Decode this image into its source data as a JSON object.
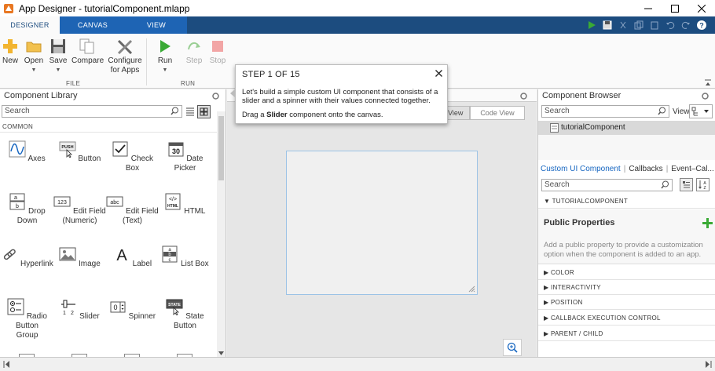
{
  "window": {
    "title": "App Designer - tutorialComponent.mlapp"
  },
  "tabs": [
    {
      "label": "DESIGNER"
    },
    {
      "label": "CANVAS"
    },
    {
      "label": "VIEW"
    }
  ],
  "toolstrip": {
    "new": "New",
    "open": "Open",
    "save": "Save",
    "compare": "Compare",
    "configure_l1": "Configure",
    "configure_l2": "for Apps",
    "run": "Run",
    "step": "Step",
    "stop": "Stop",
    "file_group": "FILE",
    "run_group": "RUN"
  },
  "library": {
    "title": "Component Library",
    "search_placeholder": "Search",
    "section": "COMMON",
    "components": [
      {
        "l1": "Axes",
        "l2": "",
        "l3": ""
      },
      {
        "l1": "Button",
        "l2": "",
        "l3": ""
      },
      {
        "l1": "Check Box",
        "l2": "",
        "l3": ""
      },
      {
        "l1": "Date Picker",
        "l2": "",
        "l3": ""
      },
      {
        "l1": "Drop Down",
        "l2": "",
        "l3": ""
      },
      {
        "l1": "Edit Field",
        "l2": "(Numeric)",
        "l3": ""
      },
      {
        "l1": "Edit Field",
        "l2": "(Text)",
        "l3": ""
      },
      {
        "l1": "HTML",
        "l2": "",
        "l3": ""
      },
      {
        "l1": "Hyperlink",
        "l2": "",
        "l3": ""
      },
      {
        "l1": "Image",
        "l2": "",
        "l3": ""
      },
      {
        "l1": "Label",
        "l2": "",
        "l3": ""
      },
      {
        "l1": "List Box",
        "l2": "",
        "l3": ""
      },
      {
        "l1": "Radio Button",
        "l2": "Group",
        "l3": ""
      },
      {
        "l1": "Slider",
        "l2": "",
        "l3": ""
      },
      {
        "l1": "Spinner",
        "l2": "",
        "l3": ""
      },
      {
        "l1": "State Button",
        "l2": "",
        "l3": ""
      }
    ],
    "icon_text": {
      "button": "PUSH",
      "date": "30",
      "dd_a": "a",
      "dd_b": "b",
      "ef_num": "123",
      "ef_txt": "abc",
      "html": "</>",
      "html_sub": "HTML",
      "label": "A",
      "slider_1": "1",
      "slider_2": "2",
      "spinner": "0",
      "state": "STATE",
      "list_a": "a",
      "list_b": "b",
      "list_c": "c"
    }
  },
  "canvas": {
    "code_view": "Code View",
    "design_view_partial": "n View"
  },
  "browser": {
    "title": "Component Browser",
    "search_placeholder": "Search",
    "view_label": "View:",
    "tree_item": "tutorialComponent",
    "tab_custom": "Custom UI Component",
    "tab_callbacks": "Callbacks",
    "tab_events": "Event–Cal...",
    "props_search_placeholder": "Search",
    "category_tutorial": "TUTORIALCOMPONENT",
    "public_properties": "Public Properties",
    "public_desc": "Add a public property to provide a customization option when the component is added to an app.",
    "categories": [
      "COLOR",
      "INTERACTIVITY",
      "POSITION",
      "CALLBACK EXECUTION CONTROL",
      "PARENT / CHILD"
    ]
  },
  "popup": {
    "step": "STEP 1 OF 15",
    "body": "Let's build a simple custom UI component that consists of a slider and a spinner with their values connected together.",
    "instr_pre": "Drag a ",
    "instr_bold": "Slider",
    "instr_post": " component onto the canvas."
  },
  "colors": {
    "tab_bar": "#1c4c7f",
    "accent": "#1565c0",
    "run_green": "#3aaa35"
  }
}
